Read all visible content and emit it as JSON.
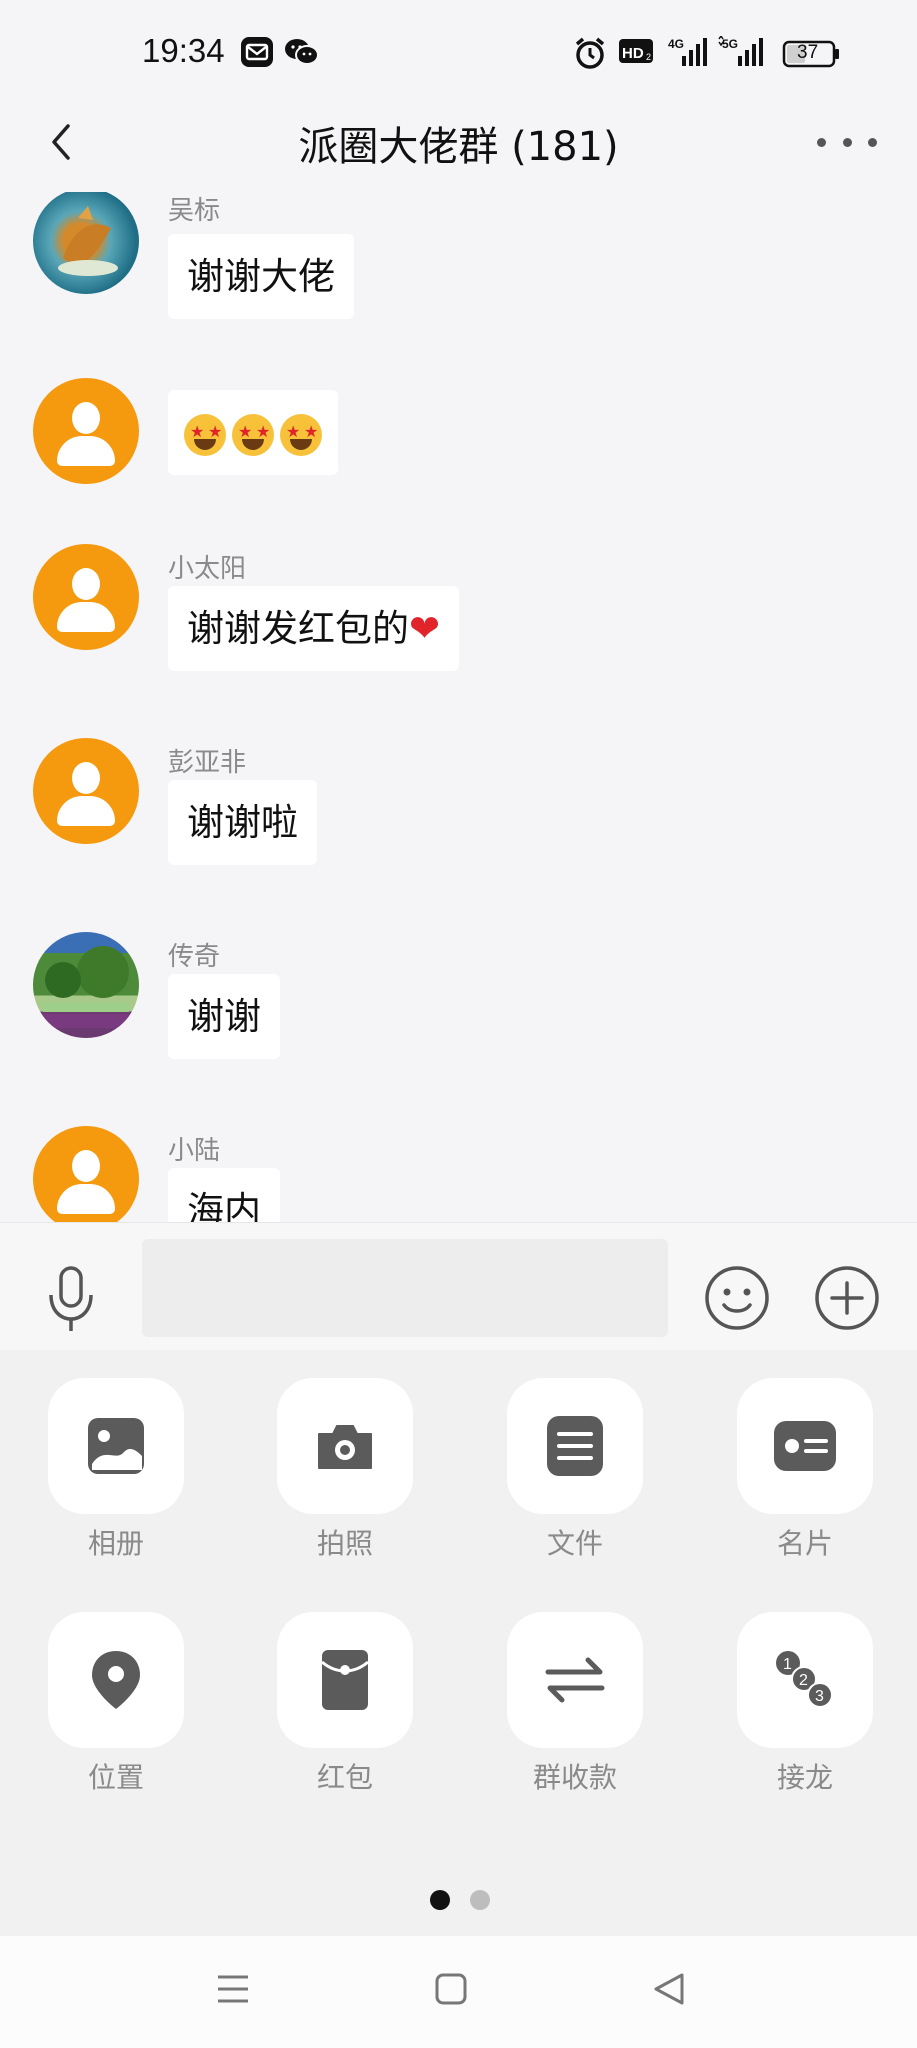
{
  "status_bar": {
    "time": "19:34",
    "network_1": "4G",
    "network_2": "5G",
    "battery": "37",
    "icons": [
      "mail-icon",
      "wechat-icon",
      "alarm-icon",
      "hd-icon",
      "signal-icon",
      "battery-icon"
    ]
  },
  "header": {
    "title": "派圈大佬群 (181)",
    "back_icon": "chevron-left-icon",
    "more_icon": "more-dots-icon"
  },
  "messages": [
    {
      "sender": "吴标",
      "text": "谢谢大佬",
      "avatar": "tiger-photo"
    },
    {
      "sender": "",
      "text": "",
      "emoji": [
        "star-struck",
        "star-struck",
        "star-struck"
      ],
      "avatar": "default"
    },
    {
      "sender": "小太阳",
      "text": "谢谢发红包的",
      "suffix_emoji": "❤",
      "avatar": "default"
    },
    {
      "sender": "彭亚非",
      "text": "谢谢啦",
      "avatar": "default"
    },
    {
      "sender": "传奇",
      "text": "谢谢",
      "avatar": "garden-photo"
    },
    {
      "sender": "小陆",
      "text": "海内",
      "avatar": "default"
    }
  ],
  "input": {
    "value": "",
    "placeholder": ""
  },
  "panel": {
    "items": [
      {
        "label": "相册",
        "icon": "album-icon"
      },
      {
        "label": "拍照",
        "icon": "camera-icon"
      },
      {
        "label": "文件",
        "icon": "file-icon"
      },
      {
        "label": "名片",
        "icon": "contact-card-icon"
      },
      {
        "label": "位置",
        "icon": "location-icon"
      },
      {
        "label": "红包",
        "icon": "red-packet-icon"
      },
      {
        "label": "群收款",
        "icon": "group-collect-icon"
      },
      {
        "label": "接龙",
        "icon": "solitaire-icon"
      }
    ],
    "page_count": 2,
    "current_page": 1
  },
  "colors": {
    "accent_avatar": "#f59a0f",
    "icon_gray": "#5b5b5b",
    "label_gray": "#8a8a8a"
  }
}
